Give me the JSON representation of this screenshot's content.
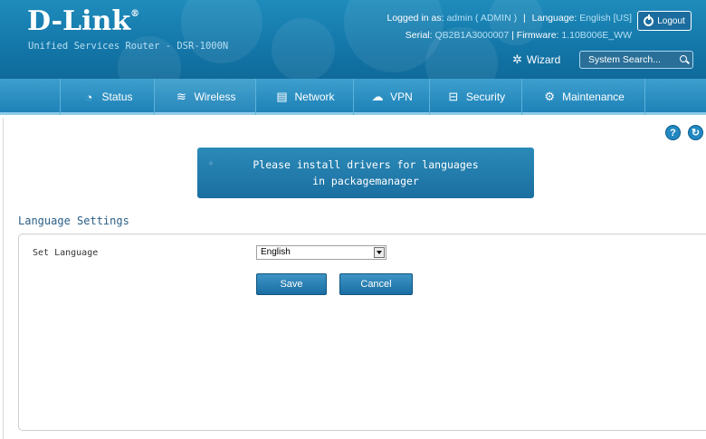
{
  "header": {
    "logo": "D-Link",
    "logo_mark": "®",
    "subtitle": "Unified Services Router - DSR-1000N",
    "logged_in_label": "Logged in as:",
    "logged_in_value": "admin ( ADMIN )",
    "language_label": "Language:",
    "language_value": "English [US]",
    "serial_label": "Serial:",
    "serial_value": "QB2B1A3000007",
    "firmware_label": "Firmware:",
    "firmware_value": "1.10B006E_WW",
    "logout_label": "Logout",
    "wizard_label": "Wizard",
    "search_placeholder": "System Search..."
  },
  "nav": {
    "items": [
      {
        "label": "Status",
        "icon": "speedometer-icon"
      },
      {
        "label": "Wireless",
        "icon": "wifi-icon"
      },
      {
        "label": "Network",
        "icon": "server-icon"
      },
      {
        "label": "VPN",
        "icon": "cloud-lock-icon"
      },
      {
        "label": "Security",
        "icon": "lock-icon"
      },
      {
        "label": "Maintenance",
        "icon": "gears-icon"
      }
    ]
  },
  "notice": {
    "message": "Please install drivers for languages in packagemanager",
    "bullet": "◦"
  },
  "section": {
    "title": "Language Settings"
  },
  "form": {
    "language_label": "Set Language",
    "language_selected": "English",
    "save_label": "Save",
    "cancel_label": "Cancel"
  },
  "icons": {
    "help": "?",
    "refresh": "↻"
  },
  "colors": {
    "header_blue": "#1478aa",
    "nav_blue": "#1e82b8",
    "button_blue": "#1b6ea3",
    "section_title": "#2a5f86"
  }
}
